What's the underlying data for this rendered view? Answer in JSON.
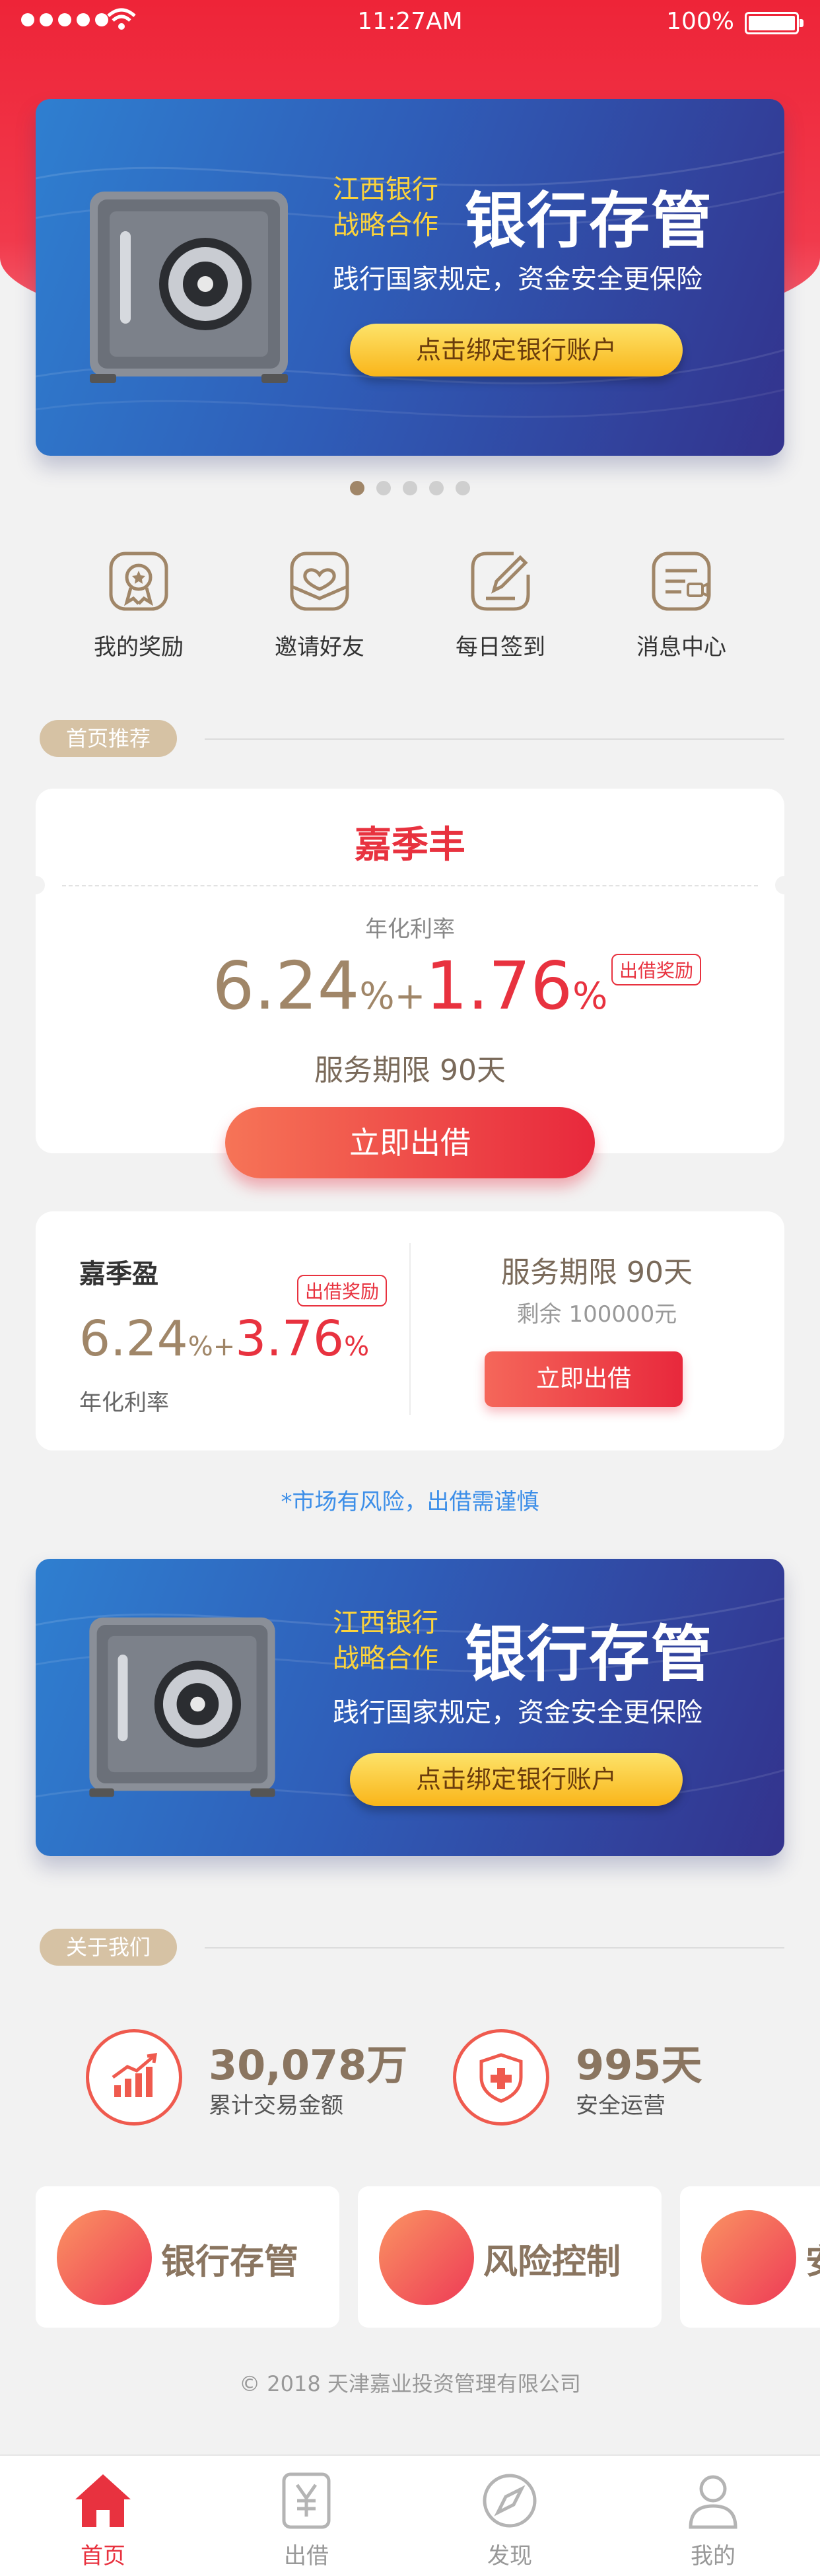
{
  "status_bar": {
    "time": "11:27AM",
    "battery": "100%"
  },
  "banner": {
    "partner_line1": "江西银行",
    "partner_line2": "战略合作",
    "title": "银行存管",
    "subtitle": "践行国家规定，资金安全更保险",
    "button": "点击绑定银行账户"
  },
  "carousel": {
    "count": 5,
    "active": 0
  },
  "quick_actions": [
    {
      "label": "我的奖励",
      "icon": "reward-badge-icon"
    },
    {
      "label": "邀请好友",
      "icon": "invite-heart-icon"
    },
    {
      "label": "每日签到",
      "icon": "sign-in-pencil-icon"
    },
    {
      "label": "消息中心",
      "icon": "message-center-icon"
    }
  ],
  "recommend": {
    "section_title": "首页推荐",
    "featured": {
      "name": "嘉季丰",
      "rate_label": "年化利率",
      "base_rate": "6.24",
      "bonus_rate": "1.76",
      "percent": "%",
      "plus": "+",
      "reward_tag": "出借奖励",
      "term": "服务期限  90天",
      "button": "立即出借"
    },
    "secondary": {
      "name": "嘉季盈",
      "reward_tag": "出借奖励",
      "base_rate": "6.24",
      "bonus_rate": "3.76",
      "percent": "%",
      "plus": "+",
      "rate_label": "年化利率",
      "term": "服务期限  90天",
      "remaining": "剩余 100000元",
      "button": "立即出借"
    },
    "risk_note": "*市场有风险，出借需谨慎"
  },
  "about": {
    "section_title": "关于我们",
    "stats": [
      {
        "value": "30,078万",
        "label": "累计交易金额",
        "icon": "chart-bars-icon"
      },
      {
        "value": "995天",
        "label": "安全运营",
        "icon": "shield-cross-icon"
      }
    ],
    "features": [
      {
        "label": "银行存管"
      },
      {
        "label": "风险控制"
      },
      {
        "label": "安"
      }
    ]
  },
  "copyright": "© 2018 天津嘉业投资管理有限公司",
  "tabs": [
    {
      "label": "首页",
      "icon": "home-icon",
      "active": true
    },
    {
      "label": "出借",
      "icon": "yen-icon",
      "active": false
    },
    {
      "label": "发现",
      "icon": "compass-icon",
      "active": false
    },
    {
      "label": "我的",
      "icon": "profile-icon",
      "active": false
    }
  ],
  "colors": {
    "brand_red": "#e8323f",
    "gold": "#a08668",
    "banner_blue": "#2f5db8",
    "banner_yellow": "#fcd33c",
    "link_blue": "#3c8ee8"
  }
}
